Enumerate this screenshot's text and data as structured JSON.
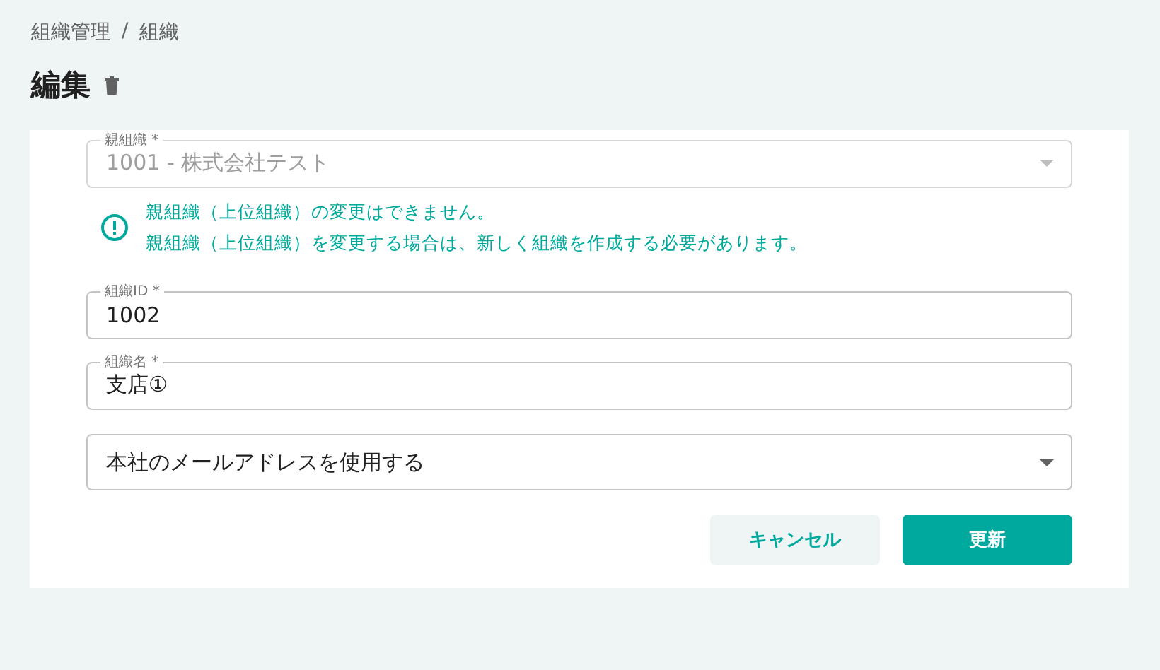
{
  "breadcrumb": [
    "組織管理",
    "/",
    "組織"
  ],
  "title": "編集",
  "fields": [
    {
      "kind": "select",
      "label": "親組織 *",
      "value": "1001 - 株式会社テスト",
      "disabled": true,
      "notice": [
        "親組織（上位組織）の変更はできません。",
        "親組織（上位組織）を変更する場合は、新しく組織を作成する必要があります。"
      ]
    },
    {
      "kind": "text",
      "label": "組織ID *",
      "value": "1002",
      "disabled": false
    },
    {
      "kind": "text",
      "label": "組織名 *",
      "value": "支店①",
      "disabled": false
    },
    {
      "kind": "select",
      "value": "本社のメールアドレスを使用する",
      "disabled": false
    }
  ],
  "buttons": [
    {
      "label": "キャンセル",
      "kind": "secondary"
    },
    {
      "label": "更新",
      "kind": "primary"
    }
  ]
}
